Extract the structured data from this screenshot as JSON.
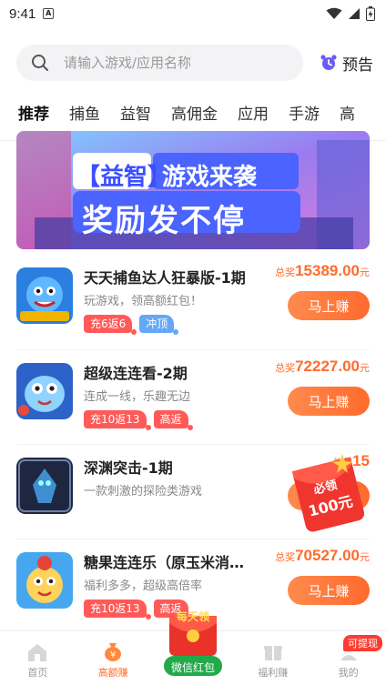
{
  "status_bar": {
    "time": "9:41",
    "sim_letter": "A"
  },
  "search": {
    "placeholder": "请输入游戏/应用名称"
  },
  "preview": {
    "label": "预告"
  },
  "tabs": [
    {
      "label": "推荐"
    },
    {
      "label": "捕鱼"
    },
    {
      "label": "益智"
    },
    {
      "label": "高佣金"
    },
    {
      "label": "应用"
    },
    {
      "label": "手游"
    },
    {
      "label": "高"
    }
  ],
  "banner": {
    "tag": "【益智】",
    "line1": "游戏来袭",
    "line2": "奖励发不停"
  },
  "prize_label": "总奖",
  "prize_unit": "元",
  "earn_label": "马上赚",
  "games": [
    {
      "title": "天天捕鱼达人狂暴版-1期",
      "desc": "玩游戏，领高额红包！",
      "prize": "15389.00",
      "tags": [
        {
          "text": "充6返6",
          "color": "red"
        },
        {
          "text": "冲顶",
          "color": "blue"
        }
      ]
    },
    {
      "title": "超级连连看-2期",
      "desc": "连成一线，乐趣无边",
      "prize": "72227.00",
      "tags": [
        {
          "text": "充10返13",
          "color": "red"
        },
        {
          "text": "高返",
          "color": "red"
        }
      ]
    },
    {
      "title": "深渊突击-1期",
      "desc": "一款刺激的探险类游戏",
      "prize": "15",
      "tags": []
    },
    {
      "title": "糖果连连乐（原玉米消…",
      "desc": "福利多多，超级高倍率",
      "prize": "70527.00",
      "tags": [
        {
          "text": "充10返13",
          "color": "red"
        },
        {
          "text": "高返",
          "color": "red"
        }
      ]
    }
  ],
  "float_packet": {
    "line1": "必领",
    "line2": "100元"
  },
  "bottom_nav": {
    "home": "首页",
    "earn": "高额赚",
    "center_top": "每天领",
    "center_bottom": "微信红包",
    "welfare": "福利赚",
    "mine": "我的",
    "withdraw_badge": "可提现"
  },
  "colors": {
    "accent": "#ff6b2c",
    "tag_red": "#ff5a58",
    "tag_blue": "#64a8f6"
  }
}
